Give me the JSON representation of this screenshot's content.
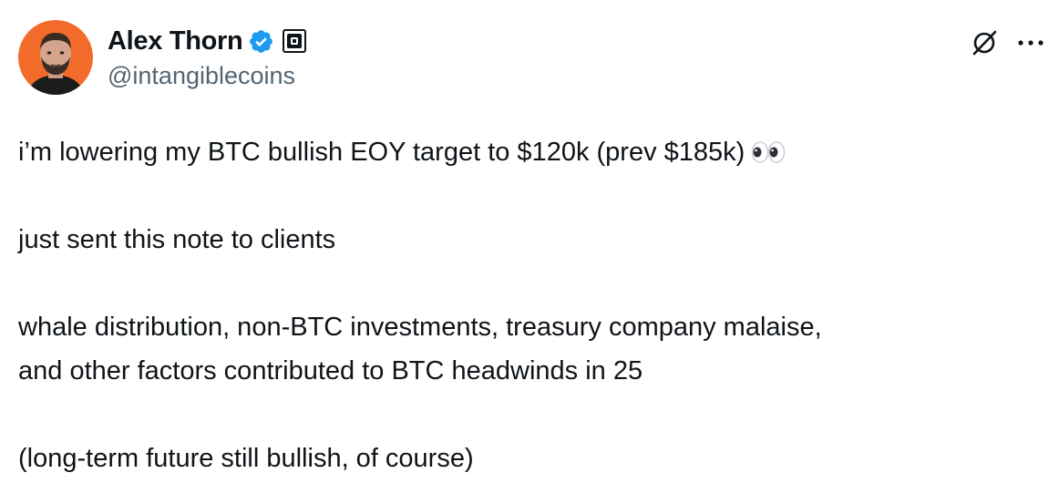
{
  "author": {
    "display_name": "Alex Thorn",
    "handle": "@intangiblecoins",
    "avatar_icon": "avatar-photo",
    "verified_icon": "verified-badge-icon",
    "affiliate_icon": "affiliate-badge-icon",
    "verified_color": "#1d9bf0"
  },
  "header_actions": {
    "grok_icon": "grok-icon",
    "more_icon": "more-options-icon"
  },
  "tweet": {
    "line1": "i’m lowering my BTC bullish EOY target to $120k (prev $185k)",
    "line1_emoji": "eyes-emoji",
    "line2": "just sent this note to clients",
    "line3": "whale distribution, non-BTC investments, treasury company malaise,",
    "line4": "and other factors contributed to BTC headwinds in 25",
    "line5": "(long-term future still bullish, of course)"
  },
  "colors": {
    "text": "#0f1419",
    "secondary": "#536471",
    "avatar_bg": "#f26b2a"
  }
}
